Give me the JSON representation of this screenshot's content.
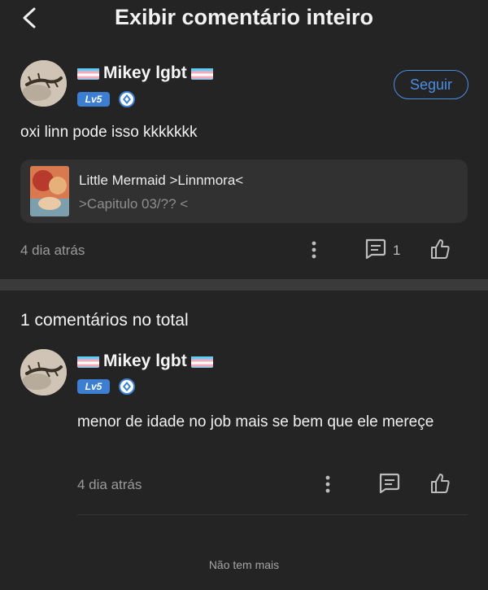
{
  "header": {
    "title": "Exibir comentário inteiro",
    "back_icon": "chevron-left-icon"
  },
  "post": {
    "user": {
      "name": "Mikey lgbt",
      "level": "Lv5",
      "flag_icon": "trans-flag-icon"
    },
    "follow_label": "Seguir",
    "text": "oxi linn pode isso kkkkkkk",
    "linked_story": {
      "title": "Little Mermaid >Linnmora<",
      "subtitle": ">Capitulo 03/?? <"
    },
    "time": "4 dia atrás",
    "comment_count": "1"
  },
  "comments_section": {
    "title": "1 comentários no total"
  },
  "reply": {
    "user": {
      "name": "Mikey lgbt",
      "level": "Lv5"
    },
    "text": "menor de idade no job mais se bem que ele mereçe",
    "time": "4 dia atrás"
  },
  "footer": {
    "text": "Não tem mais"
  },
  "colors": {
    "background": "#242424",
    "accent": "#4a8ee4",
    "badge": "#3c7ed2"
  }
}
